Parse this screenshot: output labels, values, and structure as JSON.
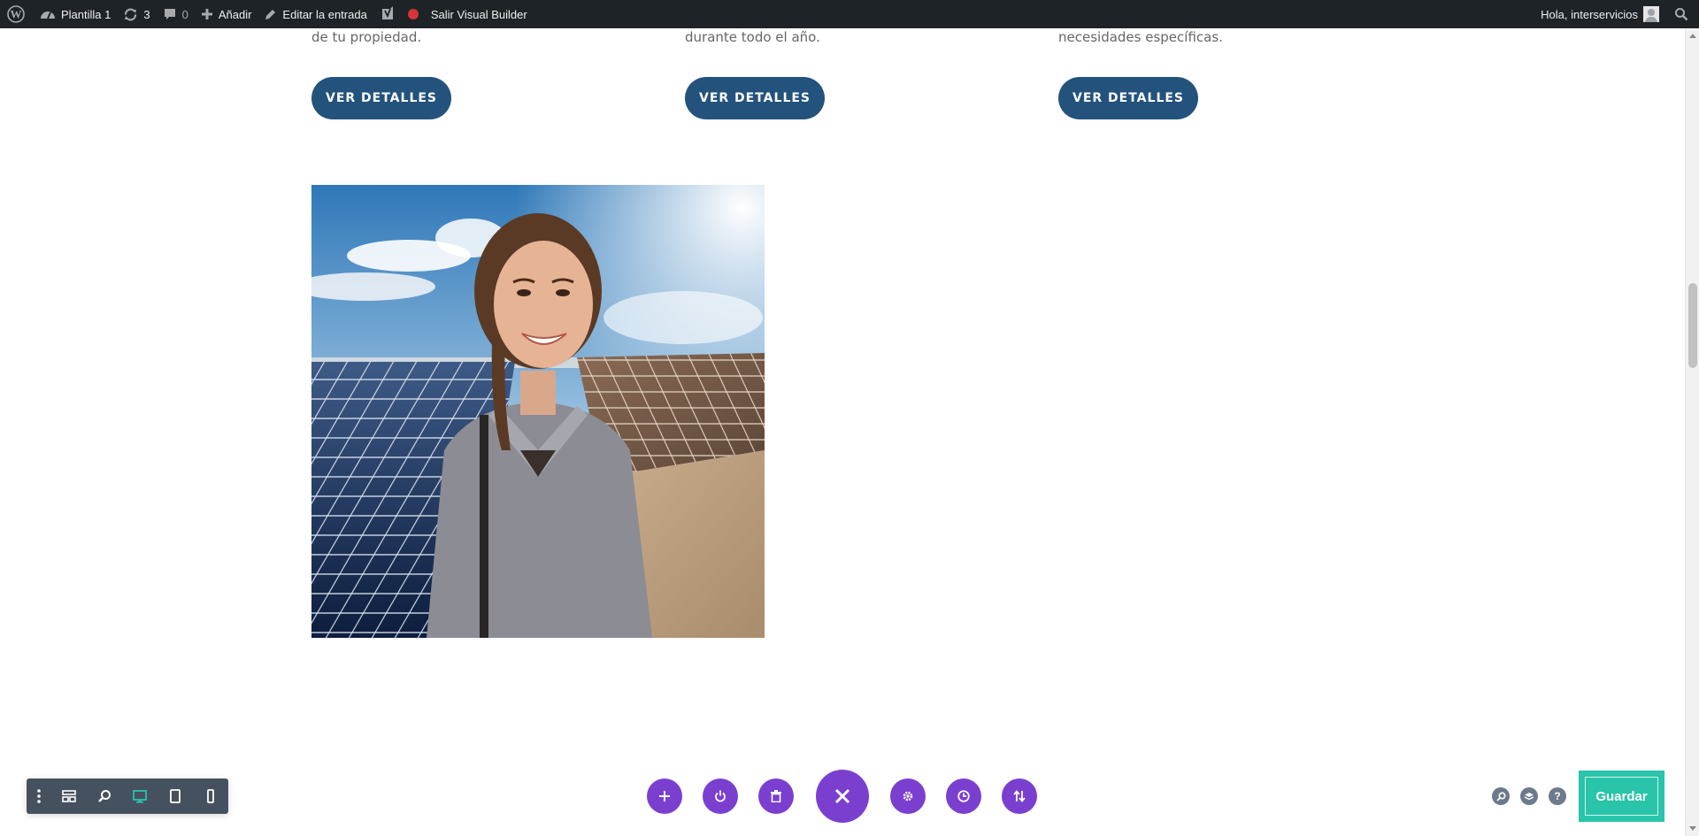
{
  "admin_bar": {
    "site_name": "Plantilla 1",
    "updates_count": "3",
    "comments_count": "0",
    "add_new": "Añadir",
    "edit_post": "Editar la entrada",
    "exit_builder": "Salir Visual Builder",
    "greeting": "Hola, interservicios"
  },
  "content": {
    "columns": [
      {
        "text_tail": "de tu propiedad.",
        "button": "VER DETALLES"
      },
      {
        "text_tail": "durante todo el año.",
        "button": "VER DETALLES"
      },
      {
        "text_tail": "necesidades específicas.",
        "button": "VER DETALLES"
      }
    ]
  },
  "divi": {
    "save_label": "Guardar",
    "help_label": "?"
  },
  "colors": {
    "admin_bar_bg": "#1d2327",
    "button_blue": "#23527c",
    "divi_purple": "#7b3fd0",
    "save_teal": "#29c4a9",
    "toolbar_gray": "#465160"
  }
}
